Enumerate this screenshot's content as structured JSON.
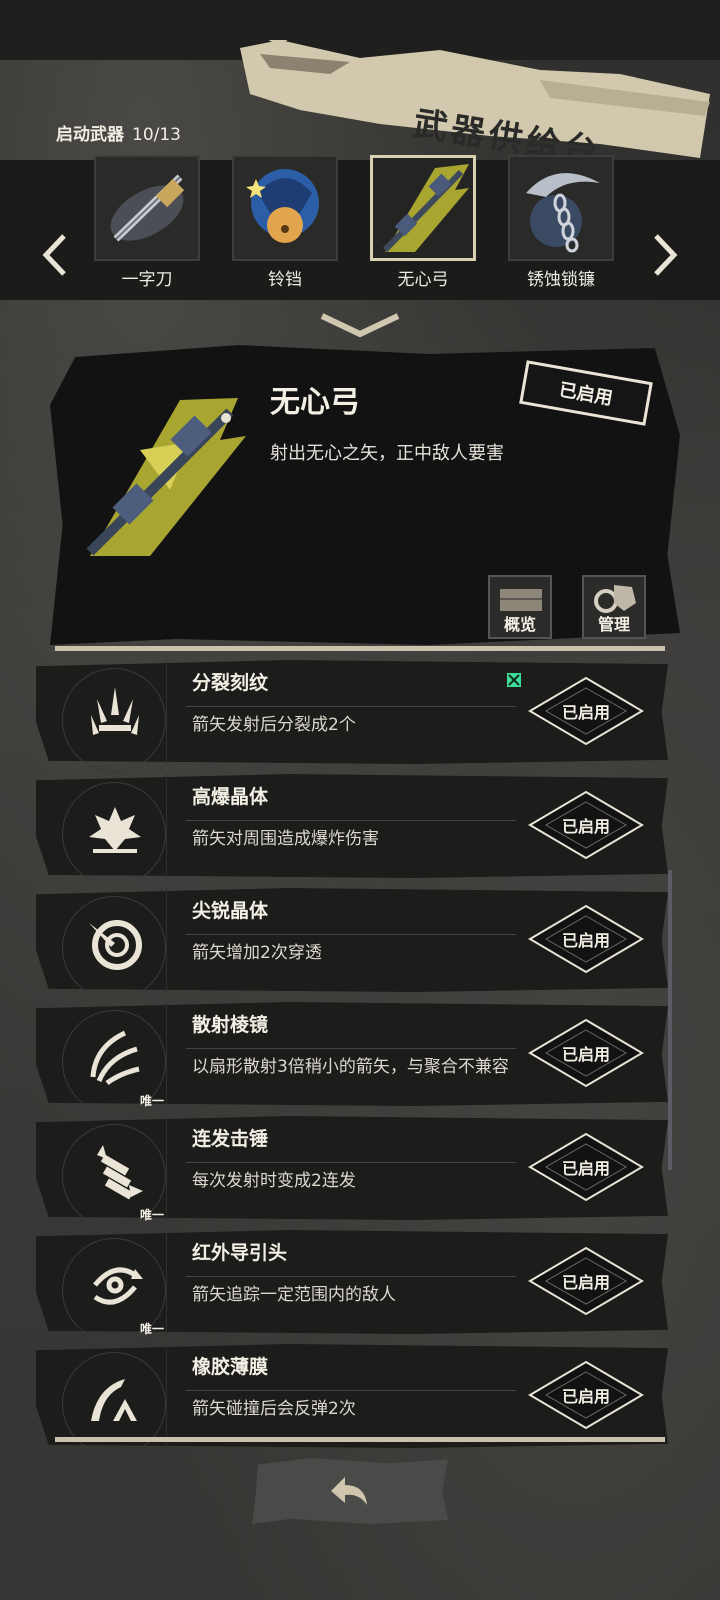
{
  "header": {
    "title": "武器供给台",
    "launch_label": "启动武器",
    "launch_count": "10/13"
  },
  "weapons": [
    {
      "name": "一字刀",
      "selected": false
    },
    {
      "name": "铃铛",
      "selected": false
    },
    {
      "name": "无心弓",
      "selected": true
    },
    {
      "name": "锈蚀锁镰",
      "selected": false
    }
  ],
  "detail": {
    "title": "无心弓",
    "description": "射出无心之矢，正中敌人要害",
    "status": "已启用",
    "overview_label": "概览",
    "manage_label": "管理"
  },
  "modules": [
    {
      "title": "分裂刻纹",
      "desc": "箭矢发射后分裂成2个",
      "tag": "",
      "status": "已启用",
      "icon": "split-arrows-icon"
    },
    {
      "title": "高爆晶体",
      "desc": "箭矢对周围造成爆炸伤害",
      "tag": "",
      "status": "已启用",
      "icon": "explosion-icon"
    },
    {
      "title": "尖锐晶体",
      "desc": "箭矢增加2次穿透",
      "tag": "",
      "status": "已启用",
      "icon": "target-pierce-icon"
    },
    {
      "title": "散射棱镜",
      "desc": "以扇形散射3倍稍小的箭矢，与聚合不兼容",
      "tag": "唯一",
      "status": "已启用",
      "icon": "scatter-wave-icon"
    },
    {
      "title": "连发击锤",
      "desc": "每次发射时变成2连发",
      "tag": "唯一",
      "status": "已启用",
      "icon": "hammer-burst-icon"
    },
    {
      "title": "红外导引头",
      "desc": "箭矢追踪一定范围内的敌人",
      "tag": "唯一",
      "status": "已启用",
      "icon": "homing-swirl-icon"
    },
    {
      "title": "橡胶薄膜",
      "desc": "箭矢碰撞后会反弹2次",
      "tag": "",
      "status": "已启用",
      "icon": "bounce-icon"
    }
  ],
  "colors": {
    "accent": "#d9cfb1",
    "new_marker": "#3ddc97"
  }
}
